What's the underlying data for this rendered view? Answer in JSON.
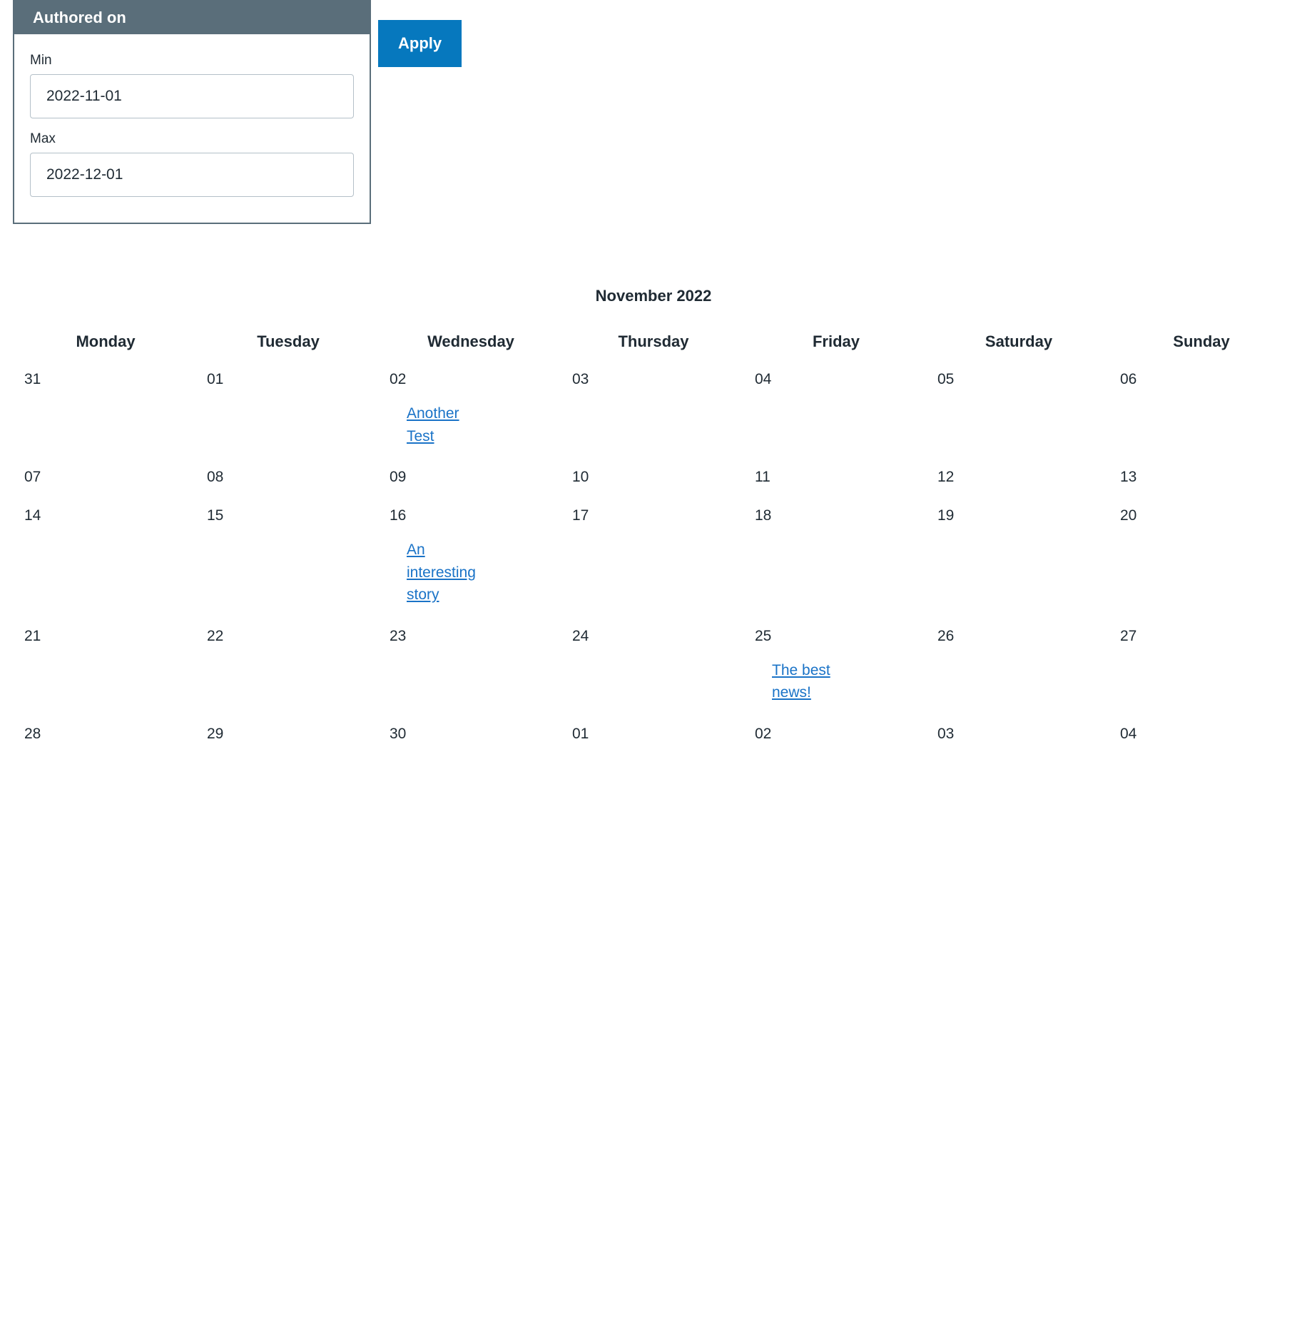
{
  "filter": {
    "title": "Authored on",
    "min_label": "Min",
    "min_value": "2022-11-01",
    "max_label": "Max",
    "max_value": "2022-12-01",
    "apply_label": "Apply"
  },
  "calendar": {
    "title": "November 2022",
    "weekdays": [
      "Monday",
      "Tuesday",
      "Wednesday",
      "Thursday",
      "Friday",
      "Saturday",
      "Sunday"
    ],
    "weeks": [
      [
        {
          "day": "31",
          "event": null
        },
        {
          "day": "01",
          "event": null
        },
        {
          "day": "02",
          "event": "Another Test"
        },
        {
          "day": "03",
          "event": null
        },
        {
          "day": "04",
          "event": null
        },
        {
          "day": "05",
          "event": null
        },
        {
          "day": "06",
          "event": null
        }
      ],
      [
        {
          "day": "07",
          "event": null
        },
        {
          "day": "08",
          "event": null
        },
        {
          "day": "09",
          "event": null
        },
        {
          "day": "10",
          "event": null
        },
        {
          "day": "11",
          "event": null
        },
        {
          "day": "12",
          "event": null
        },
        {
          "day": "13",
          "event": null
        }
      ],
      [
        {
          "day": "14",
          "event": null
        },
        {
          "day": "15",
          "event": null
        },
        {
          "day": "16",
          "event": "An interesting story"
        },
        {
          "day": "17",
          "event": null
        },
        {
          "day": "18",
          "event": null
        },
        {
          "day": "19",
          "event": null
        },
        {
          "day": "20",
          "event": null
        }
      ],
      [
        {
          "day": "21",
          "event": null
        },
        {
          "day": "22",
          "event": null
        },
        {
          "day": "23",
          "event": null
        },
        {
          "day": "24",
          "event": null
        },
        {
          "day": "25",
          "event": "The best news!"
        },
        {
          "day": "26",
          "event": null
        },
        {
          "day": "27",
          "event": null
        }
      ],
      [
        {
          "day": "28",
          "event": null
        },
        {
          "day": "29",
          "event": null
        },
        {
          "day": "30",
          "event": null
        },
        {
          "day": "01",
          "event": null
        },
        {
          "day": "02",
          "event": null
        },
        {
          "day": "03",
          "event": null
        },
        {
          "day": "04",
          "event": null
        }
      ]
    ]
  }
}
